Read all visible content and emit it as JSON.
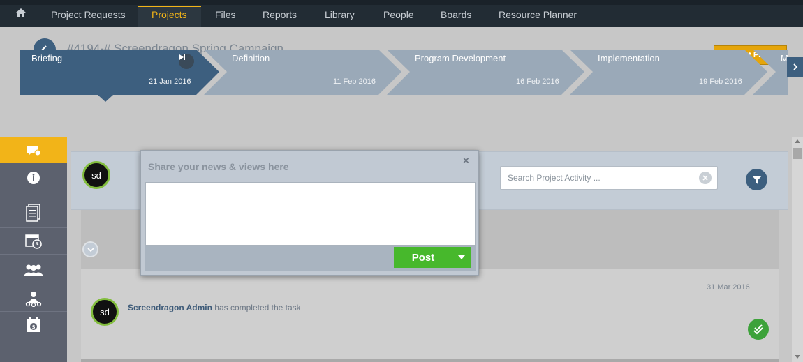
{
  "nav": {
    "items": [
      "Project Requests",
      "Projects",
      "Files",
      "Reports",
      "Library",
      "People",
      "Boards",
      "Resource Planner"
    ],
    "active": "Projects"
  },
  "header": {
    "title": "#4194-# Screendragon Spring Campaign",
    "edit_label": "Edit Project"
  },
  "stages": [
    {
      "label": "Briefing",
      "date": "21 Jan 2016",
      "active": true
    },
    {
      "label": "Definition",
      "date": "11 Feb 2016",
      "active": false
    },
    {
      "label": "Program Development",
      "date": "16 Feb 2016",
      "active": false
    },
    {
      "label": "Implementation",
      "date": "19 Feb 2016",
      "active": false
    },
    {
      "label": "M",
      "date": "",
      "active": false
    }
  ],
  "sidebar": {
    "icons": [
      "comment-icon",
      "info-icon",
      "document-list-icon",
      "calendar-clock-icon",
      "team-icon",
      "org-chart-icon",
      "budget-calendar-icon"
    ]
  },
  "activity": {
    "avatar_text": "sd",
    "search_placeholder": "Search Project Activity ..."
  },
  "popup": {
    "title": "Share your news & views here",
    "close": "×",
    "textarea_value": "",
    "post_label": "Post"
  },
  "feed": [
    {
      "date": "31 Mar 2016",
      "user": "Screendragon Admin",
      "action": "has completed the task",
      "avatar_text": "sd"
    }
  ],
  "colors": {
    "accent": "#f2b418",
    "primary": "#3d5f7f",
    "success": "#47b82c",
    "nav_bg": "#222c34"
  }
}
